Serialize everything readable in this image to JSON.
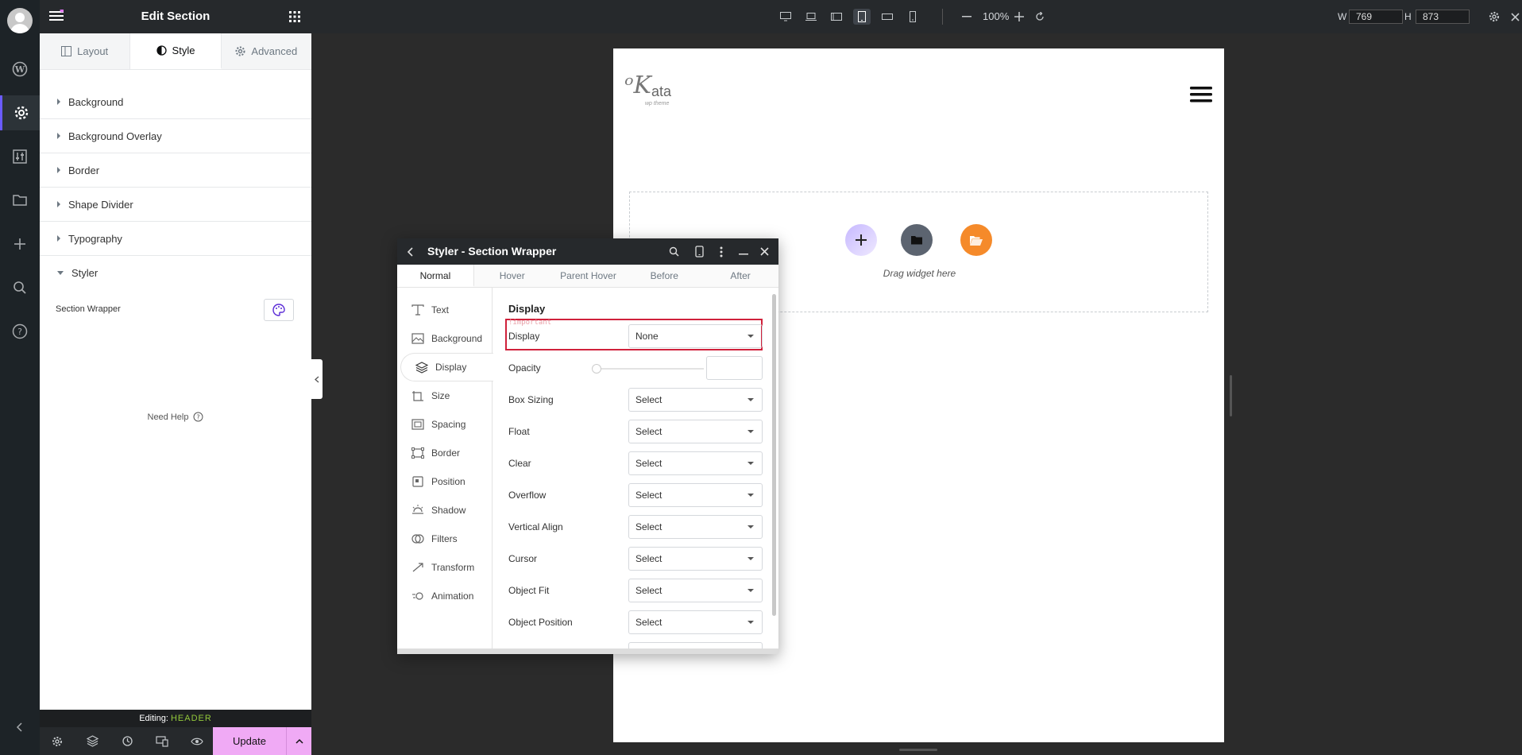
{
  "rail": {
    "items": [
      "avatar",
      "wordpress-icon",
      "gear-icon",
      "sliders-icon",
      "folder-icon",
      "plus-icon",
      "search-icon",
      "help-icon",
      "collapse-icon"
    ]
  },
  "panel": {
    "title": "Edit Section",
    "tabs": [
      {
        "label": "Layout",
        "icon": "layout-icon"
      },
      {
        "label": "Style",
        "icon": "contrast-icon"
      },
      {
        "label": "Advanced",
        "icon": "gear-icon"
      }
    ],
    "sections": [
      "Background",
      "Background Overlay",
      "Border",
      "Shape Divider",
      "Typography",
      "Styler"
    ],
    "styler_item_label": "Section Wrapper",
    "need_help": "Need Help",
    "editing_label": "Editing:",
    "editing_target": "HEADER",
    "update_label": "Update"
  },
  "topbar": {
    "zoom": "100%",
    "w_label": "W",
    "w_value": "769",
    "h_label": "H",
    "h_value": "873",
    "devices": [
      "desktop-icon",
      "laptop-icon",
      "tablet-landscape-icon",
      "tablet-portrait-icon",
      "mobile-landscape-icon",
      "mobile-portrait-icon"
    ],
    "active_device": "tablet-portrait-icon"
  },
  "canvas": {
    "logo_text": "ata",
    "logo_sub": "wp theme",
    "drag_text": "Drag widget here",
    "accent_purple": "#b9a8ff",
    "accent_gray": "#5c6470",
    "accent_orange": "#f58a2a"
  },
  "dialog": {
    "title": "Styler - Section Wrapper",
    "state_tabs": [
      "Normal",
      "Hover",
      "Parent Hover",
      "Before",
      "After"
    ],
    "side_items": [
      {
        "label": "Text",
        "icon": "text-icon"
      },
      {
        "label": "Background",
        "icon": "image-icon"
      },
      {
        "label": "Display",
        "icon": "layers-icon"
      },
      {
        "label": "Size",
        "icon": "size-icon"
      },
      {
        "label": "Spacing",
        "icon": "spacing-icon"
      },
      {
        "label": "Border",
        "icon": "border-icon"
      },
      {
        "label": "Position",
        "icon": "position-icon"
      },
      {
        "label": "Shadow",
        "icon": "shadow-icon"
      },
      {
        "label": "Filters",
        "icon": "filters-icon"
      },
      {
        "label": "Transform",
        "icon": "transform-icon"
      },
      {
        "label": "Animation",
        "icon": "animation-icon"
      }
    ],
    "section_title": "Display",
    "important_label": "!important",
    "display": {
      "label": "Display",
      "value": "None"
    },
    "opacity_label": "Opacity",
    "fields": [
      {
        "label": "Box Sizing",
        "value": "Select"
      },
      {
        "label": "Float",
        "value": "Select"
      },
      {
        "label": "Clear",
        "value": "Select"
      },
      {
        "label": "Overflow",
        "value": "Select"
      },
      {
        "label": "Vertical Align",
        "value": "Select"
      },
      {
        "label": "Cursor",
        "value": "Select"
      },
      {
        "label": "Object Fit",
        "value": "Select"
      },
      {
        "label": "Object Position",
        "value": "Select"
      }
    ]
  }
}
